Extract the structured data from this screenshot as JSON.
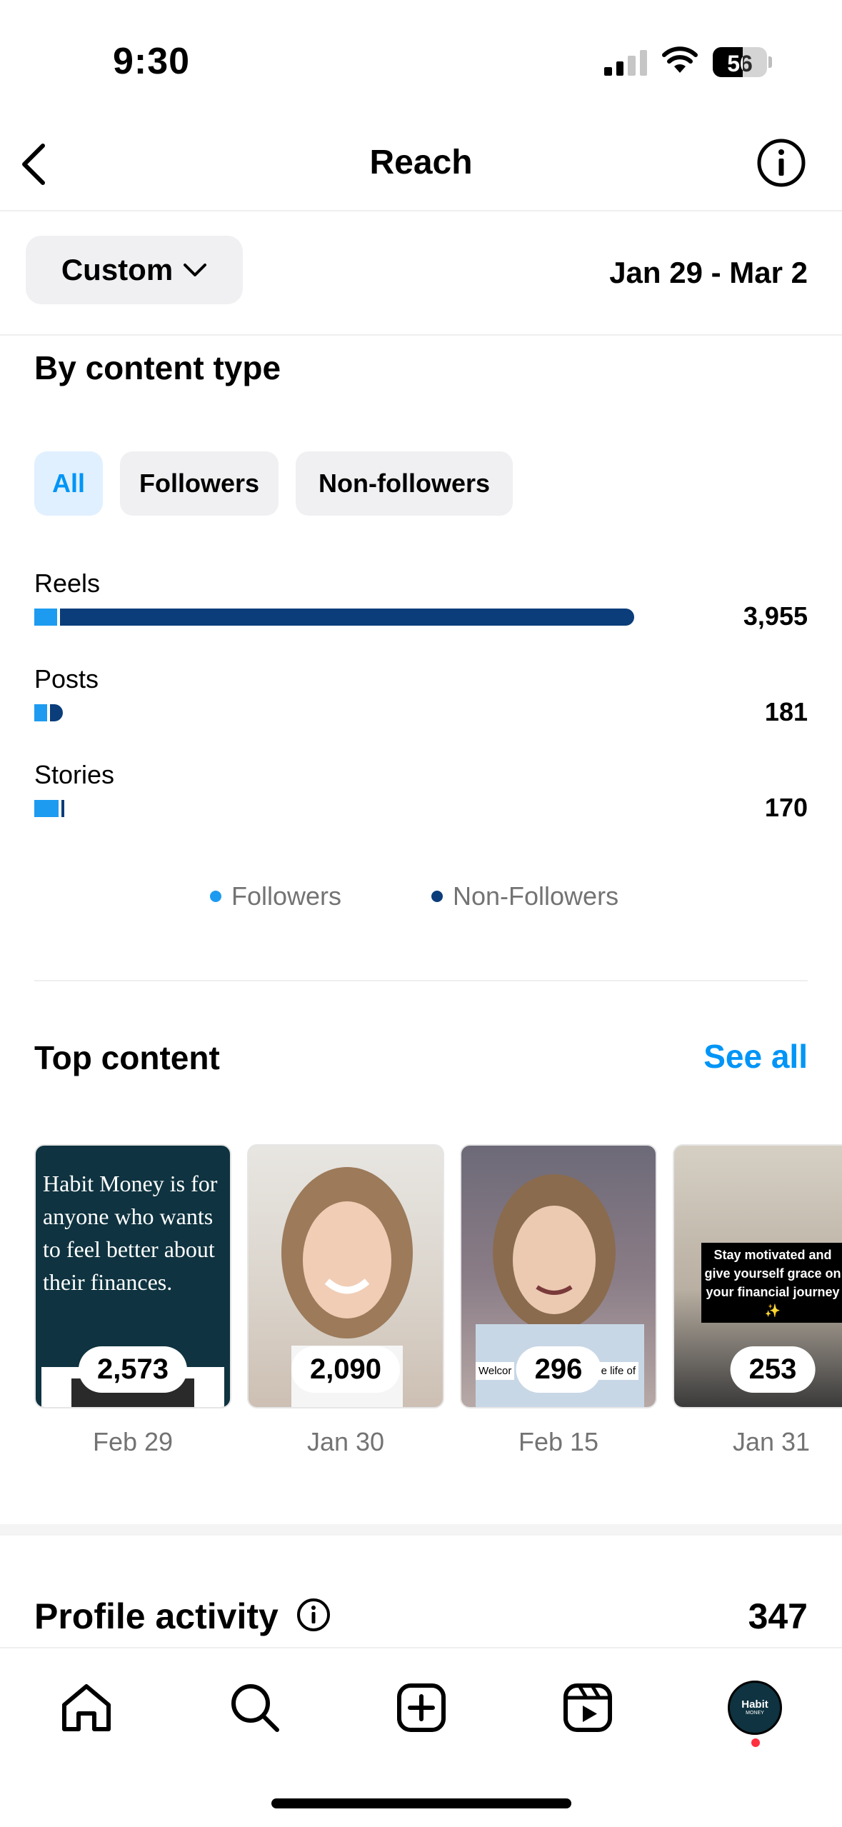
{
  "status_bar": {
    "time": "9:30",
    "battery": "56"
  },
  "header": {
    "title": "Reach"
  },
  "filter": {
    "period_label": "Custom",
    "date_range": "Jan 29 - Mar 2"
  },
  "content_type": {
    "title": "By content type",
    "chips": [
      "All",
      "Followers",
      "Non-followers"
    ],
    "selected_chip": "All",
    "rows": [
      {
        "label": "Reels",
        "value": "3,955",
        "followers_share": 0.04
      },
      {
        "label": "Posts",
        "value": "181",
        "followers_share": 0.5
      },
      {
        "label": "Stories",
        "value": "170",
        "followers_share": 0.85
      }
    ],
    "legend": [
      {
        "label": "Followers",
        "color": "#1d9bf0"
      },
      {
        "label": "Non-Followers",
        "color": "#0a3d7a"
      }
    ]
  },
  "top_content": {
    "title": "Top content",
    "see_all": "See all",
    "items": [
      {
        "value": "2,573",
        "date": "Feb 29",
        "overlay_text": "Habit Money is for anyone who wants to feel better about their finances."
      },
      {
        "value": "2,090",
        "date": "Jan 30"
      },
      {
        "value": "296",
        "date": "Feb 15",
        "caption_left": "Welcor",
        "caption_right": "e life of"
      },
      {
        "value": "253",
        "date": "Jan 31",
        "overlay_text": "Stay motivated and give yourself grace on your financial journey ✨"
      }
    ]
  },
  "profile_activity": {
    "title": "Profile activity",
    "value": "347"
  },
  "avatar": {
    "text": "Habit",
    "subtext": "MONEY"
  }
}
